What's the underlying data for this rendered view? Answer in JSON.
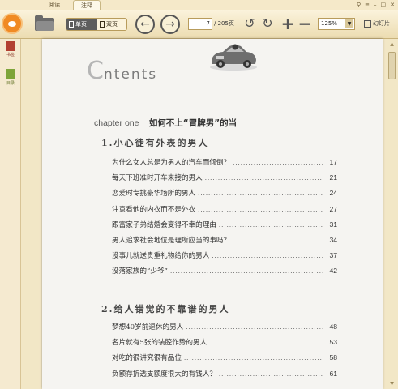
{
  "tabs": {
    "read": "阅读",
    "notes": "注释"
  },
  "window_controls": [
    "⚲",
    "≡",
    "–",
    "□",
    "✕"
  ],
  "toolbar": {
    "single_page": "单页",
    "double_page": "双页",
    "current_page": "7",
    "page_total": "/ 205页",
    "zoom": "125%",
    "slideshow": "幻灯片"
  },
  "sidebar": {
    "shelf": "书签",
    "toc": "目录"
  },
  "page": {
    "title_big": "C",
    "title_rest": "ntents",
    "chapter_en": "chapter one",
    "chapter_cn": "如何不上“冒牌男”的当",
    "sections": [
      {
        "title": "1.小心徒有外表的男人",
        "entries": [
          {
            "title": "为什么女人总是为男人的汽车而倾倒？",
            "page": "17"
          },
          {
            "title": "每天下班准时开车来接的男人",
            "page": "21"
          },
          {
            "title": "恋爱时专挑豪华场所的男人",
            "page": "24"
          },
          {
            "title": "注意看他的内衣而不是外衣",
            "page": "27"
          },
          {
            "title": "跟富家子弟结婚会变得不幸的理由",
            "page": "31"
          },
          {
            "title": "男人追求社会地位是理所应当的事吗？",
            "page": "34"
          },
          {
            "title": "没事儿就送贵重礼物给你的男人",
            "page": "37"
          },
          {
            "title": "没落家族的“少爷”",
            "page": "42"
          }
        ]
      },
      {
        "title": "2.给人错觉的不靠谱的男人",
        "entries": [
          {
            "title": "梦想40岁前退休的男人",
            "page": "48"
          },
          {
            "title": "名片就有5张的装腔作势的男人",
            "page": "53"
          },
          {
            "title": "对吃的很讲究很有品位",
            "page": "58"
          },
          {
            "title": "负额存折透支额度很大的有钱人？",
            "page": "61"
          }
        ]
      }
    ]
  }
}
